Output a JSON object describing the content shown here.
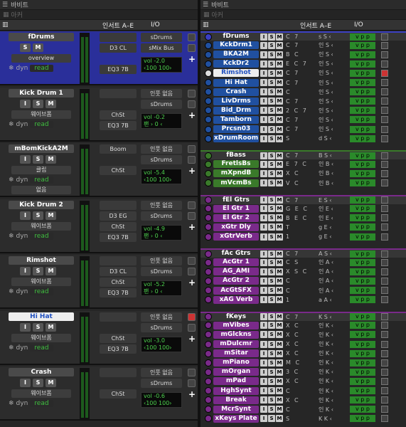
{
  "left_pane": {
    "toolbar_label": "바비트",
    "sub_label": "아커",
    "insert_header": "인서트 A–E",
    "io_header": "I/O"
  },
  "right_pane": {
    "toolbar_label": "바비트",
    "sub_label": "아커",
    "insert_header": "인서트 A–E",
    "io_header": "I/O"
  },
  "strips": [
    {
      "name": "fDrums",
      "sel": "overview",
      "dyn": "dyn",
      "read": "read",
      "ins": [
        "",
        "D3 CL",
        "",
        "EQ3 7B"
      ],
      "io": [
        "sDrums",
        "sMix Bus"
      ],
      "vol": "-2.0",
      "pan": "‹100   100›",
      "color": "#3b3fc2",
      "btns": [
        "S",
        "M"
      ],
      "extra": "",
      "red": false
    },
    {
      "name": "Kick Drum 1",
      "sel": "웨이브폼",
      "dyn": "dyn",
      "read": "read",
      "ins": [
        "",
        "",
        "ChSt",
        "EQ3 7B"
      ],
      "io": [
        "인풋 없음",
        "sDrums"
      ],
      "vol": "-0.2",
      "pan": "팬    › 0 ‹",
      "color": "#2c2c2c",
      "btns": [
        "I",
        "S",
        "M"
      ],
      "extra": "",
      "red": false
    },
    {
      "name": "mBomKickA2M",
      "sel": "클립",
      "dyn": "dyn",
      "read": "read",
      "ins": [
        "Boom",
        "",
        "ChSt",
        ""
      ],
      "io": [
        "인풋 없음",
        "sDrums"
      ],
      "vol": "-5.4",
      "pan": "‹100   100›",
      "color": "#2c2c2c",
      "btns": [
        "I",
        "S",
        "M"
      ],
      "extra": "없음",
      "red": false
    },
    {
      "name": "Kick Drum 2",
      "sel": "웨이브폼",
      "dyn": "dyn",
      "read": "read",
      "ins": [
        "",
        "D3 EG",
        "ChSt",
        "EQ3 7B"
      ],
      "io": [
        "인풋 없음",
        "sDrums"
      ],
      "vol": "-4.9",
      "pan": "팬    › 0 ‹",
      "color": "#2c2c2c",
      "btns": [
        "I",
        "S",
        "M"
      ],
      "extra": "",
      "red": false
    },
    {
      "name": "Rimshot",
      "sel": "웨이브폼",
      "dyn": "dyn",
      "read": "read",
      "ins": [
        "",
        "D3 CL",
        "ChSt",
        "EQ3 7B"
      ],
      "io": [
        "인풋 없음",
        "sDrums"
      ],
      "vol": "-5.2",
      "pan": "팬    › 0 ‹",
      "color": "#2c2c2c",
      "btns": [
        "I",
        "S",
        "M"
      ],
      "extra": "",
      "red": false
    },
    {
      "name": "Hi Hat",
      "sel": "웨이브폼",
      "dyn": "dyn",
      "read": "read",
      "ins": [
        "",
        "",
        "ChSt",
        "EQ3 7B"
      ],
      "io": [
        "인풋 없음",
        "sDrums"
      ],
      "vol": "-3.0",
      "pan": "‹100   100›",
      "color": "#2c2c2c",
      "btns": [
        "I",
        "S",
        "M"
      ],
      "extra": "",
      "red": true
    },
    {
      "name": "Crash",
      "sel": "웨이브폼",
      "dyn": "dyn",
      "read": "read",
      "ins": [
        "",
        "",
        "ChSt",
        ""
      ],
      "io": [
        "인풋 없음",
        "sDrums"
      ],
      "vol": "-0.6",
      "pan": "‹100   100›",
      "color": "#2c2c2c",
      "btns": [
        "I",
        "S",
        "M"
      ],
      "extra": "",
      "red": false
    }
  ],
  "tracks": [
    {
      "name": "fDrums",
      "group": true,
      "color": "#3b3fc2",
      "ins": "C   7",
      "io": "s S ‹",
      "red": false
    },
    {
      "name": "KckDrm1",
      "color": "#2050a0",
      "ins": "C 7",
      "io": "인 S ‹",
      "red": false
    },
    {
      "name": "BKA2M",
      "color": "#2050a0",
      "ins": "B   C",
      "io": "인 S ‹",
      "red": false
    },
    {
      "name": "KckDr2",
      "color": "#2050a0",
      "ins": "E C 7",
      "io": "인 S ‹",
      "red": false
    },
    {
      "name": "Rimshot",
      "color": "#dddddd",
      "ins": "C 7",
      "io": "인 S ‹",
      "red": true
    },
    {
      "name": "Hi Hat",
      "color": "#2050a0",
      "ins": "C 7",
      "io": "인 S ‹",
      "red": false
    },
    {
      "name": "Crash",
      "color": "#2050a0",
      "ins": "C",
      "io": "인 S ‹",
      "red": false
    },
    {
      "name": "LivDrms",
      "color": "#2050a0",
      "ins": "C 7",
      "io": "인 S ‹",
      "red": false
    },
    {
      "name": "Bid_Drm",
      "color": "#2050a0",
      "ins": "2 C 7",
      "io": "인 S ‹",
      "red": false
    },
    {
      "name": "Tamborn",
      "color": "#2050a0",
      "ins": "C 7",
      "io": "인 S ‹",
      "red": false
    },
    {
      "name": "Prcsn03",
      "color": "#2050a0",
      "ins": "C 7",
      "io": "인 S ‹",
      "red": false
    },
    {
      "name": "xDrumRoom",
      "color": "#2050a0",
      "ins": "S",
      "io": "d S ‹",
      "red": false
    },
    {
      "name": "fBass",
      "group": true,
      "color": "#3a7a2a",
      "ins": "C   7",
      "io": "B S ‹",
      "red": false
    },
    {
      "name": "FretlsBs",
      "color": "#3a7a2a",
      "ins": "E 7 C",
      "io": "인 B ‹",
      "red": false
    },
    {
      "name": "mXpndB",
      "color": "#3a7a2a",
      "ins": "X C",
      "io": "인 B ‹",
      "red": false
    },
    {
      "name": "mVcmBs",
      "color": "#3a7a2a",
      "ins": "V C",
      "io": "인 B ‹",
      "red": false
    },
    {
      "name": "fEl Gtrs",
      "group": true,
      "color": "#7a2a8a",
      "ins": "C   7",
      "io": "E S ‹",
      "red": false
    },
    {
      "name": "El Gtr 1",
      "color": "#7a2a8a",
      "ins": "G E C",
      "io": "인 E ‹",
      "red": false
    },
    {
      "name": "El Gtr 2",
      "color": "#7a2a8a",
      "ins": "B E C",
      "io": "인 E ‹",
      "red": false
    },
    {
      "name": "xGtr Dly",
      "color": "#7a2a8a",
      "ins": "T",
      "io": "g E ‹",
      "red": false
    },
    {
      "name": "xGtrVerb",
      "color": "#7a2a8a",
      "ins": "1",
      "io": "g E ‹",
      "red": false
    },
    {
      "name": "fAc Gtrs",
      "group": true,
      "color": "#7a2a8a",
      "ins": "C   7",
      "io": "A S ‹",
      "red": false
    },
    {
      "name": "AcGtr 1",
      "color": "#7a2a8a",
      "ins": "C S",
      "io": "인 A ‹",
      "red": false
    },
    {
      "name": "AG_AMI",
      "color": "#7a2a8a",
      "ins": "X S C",
      "io": "인 A ‹",
      "red": false
    },
    {
      "name": "AcGtr 2",
      "color": "#7a2a8a",
      "ins": "C",
      "io": "인 A ‹",
      "red": false
    },
    {
      "name": "AcGtSFX",
      "color": "#7a2a8a",
      "ins": "C",
      "io": "인 A ‹",
      "red": false
    },
    {
      "name": "xAG Verb",
      "color": "#7a2a8a",
      "ins": "1",
      "io": "a A ‹",
      "red": false
    },
    {
      "name": "fKeys",
      "group": true,
      "color": "#7a2a8a",
      "ins": "C   7",
      "io": "K S ‹",
      "red": false
    },
    {
      "name": "mVibes",
      "color": "#7a2a8a",
      "ins": "X C",
      "io": "인 K ‹",
      "red": false
    },
    {
      "name": "mGlckns",
      "color": "#7a2a8a",
      "ins": "X C",
      "io": "인 K ‹",
      "red": false
    },
    {
      "name": "mDulcmr",
      "color": "#7a2a8a",
      "ins": "X C",
      "io": "인 K ‹",
      "red": false
    },
    {
      "name": "mSitar",
      "color": "#7a2a8a",
      "ins": "X C",
      "io": "인 K ‹",
      "red": false
    },
    {
      "name": "mPiano",
      "color": "#7a2a8a",
      "ins": "M C",
      "io": "인 K ‹",
      "red": false
    },
    {
      "name": "mOrgan",
      "color": "#7a2a8a",
      "ins": "3 C",
      "io": "인 K ‹",
      "red": false
    },
    {
      "name": "mPad",
      "color": "#7a2a8a",
      "ins": "X C",
      "io": "인 K ‹",
      "red": false
    },
    {
      "name": "HghSynt",
      "color": "#7a2a8a",
      "ins": "C",
      "io": "인 K ‹",
      "red": false
    },
    {
      "name": "Break",
      "color": "#7a2a8a",
      "ins": "X C",
      "io": "인 K ‹",
      "red": false
    },
    {
      "name": "McrSynt",
      "color": "#7a2a8a",
      "ins": "C",
      "io": "인 K ‹",
      "red": false
    },
    {
      "name": "xKeys Plate",
      "color": "#7a2a8a",
      "ins": "S",
      "io": "K K ‹",
      "red": false
    }
  ],
  "labels": {
    "vol": "vol",
    "fx": [
      "I",
      "S",
      "M"
    ],
    "vp": "v p p"
  }
}
